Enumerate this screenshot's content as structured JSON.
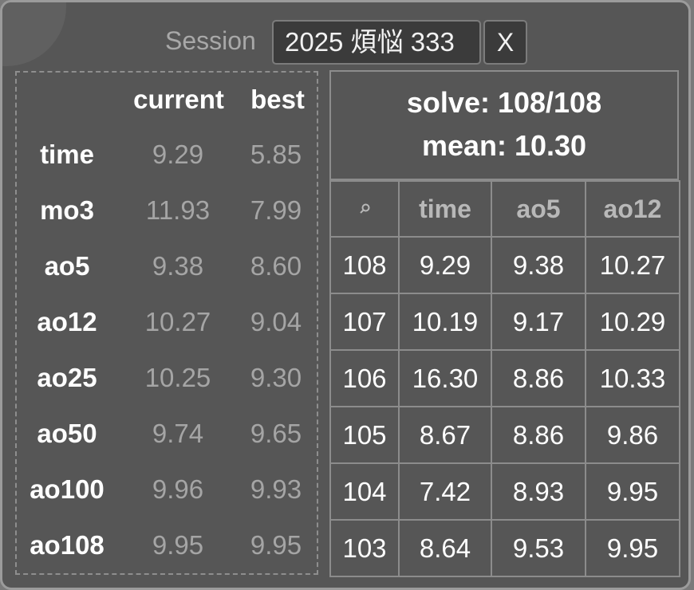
{
  "session": {
    "label": "Session",
    "selected": "2025 煩悩 333",
    "delete_label": "X"
  },
  "stats": {
    "headers": {
      "current": "current",
      "best": "best"
    },
    "rows": [
      {
        "name": "time",
        "current": "9.29",
        "best": "5.85"
      },
      {
        "name": "mo3",
        "current": "11.93",
        "best": "7.99"
      },
      {
        "name": "ao5",
        "current": "9.38",
        "best": "8.60"
      },
      {
        "name": "ao12",
        "current": "10.27",
        "best": "9.04"
      },
      {
        "name": "ao25",
        "current": "10.25",
        "best": "9.30"
      },
      {
        "name": "ao50",
        "current": "9.74",
        "best": "9.65"
      },
      {
        "name": "ao100",
        "current": "9.96",
        "best": "9.93"
      },
      {
        "name": "ao108",
        "current": "9.95",
        "best": "9.95"
      }
    ]
  },
  "summary": {
    "solve": "solve: 108/108",
    "mean": "mean: 10.30"
  },
  "solves_table": {
    "search_icon": "search-icon",
    "headers": [
      "time",
      "ao5",
      "ao12"
    ],
    "rows": [
      {
        "no": "108",
        "time": "9.29",
        "ao5": "9.38",
        "ao12": "10.27"
      },
      {
        "no": "107",
        "time": "10.19",
        "ao5": "9.17",
        "ao12": "10.29"
      },
      {
        "no": "106",
        "time": "16.30",
        "ao5": "8.86",
        "ao12": "10.33"
      },
      {
        "no": "105",
        "time": "8.67",
        "ao5": "8.86",
        "ao12": "9.86"
      },
      {
        "no": "104",
        "time": "7.42",
        "ao5": "8.93",
        "ao12": "9.95"
      },
      {
        "no": "103",
        "time": "8.64",
        "ao5": "9.53",
        "ao12": "9.95"
      }
    ]
  }
}
